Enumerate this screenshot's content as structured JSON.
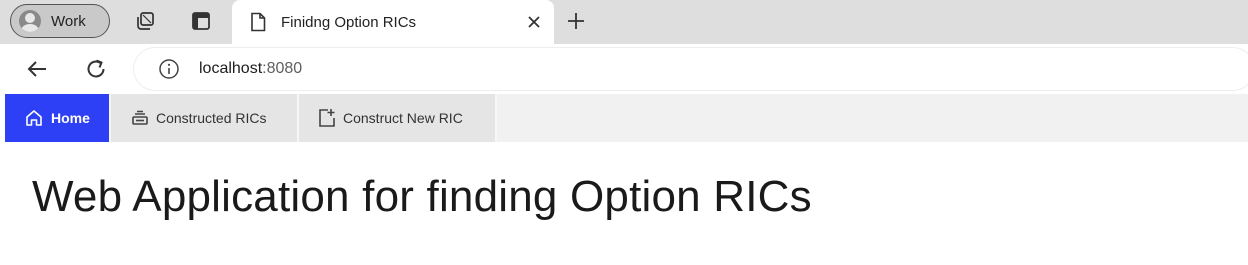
{
  "browser": {
    "profile_label": "Work",
    "tab_title": "Finidng Option RICs",
    "address": {
      "host": "localhost",
      "port": ":8080"
    }
  },
  "app": {
    "nav": [
      {
        "label": "Home",
        "icon": "home-icon",
        "active": true
      },
      {
        "label": "Constructed RICs",
        "icon": "stack-icon",
        "active": false
      },
      {
        "label": "Construct New RIC",
        "icon": "add-document-icon",
        "active": false
      }
    ],
    "heading": "Web Application for finding Option RICs",
    "accent_color": "#2e40f5"
  }
}
